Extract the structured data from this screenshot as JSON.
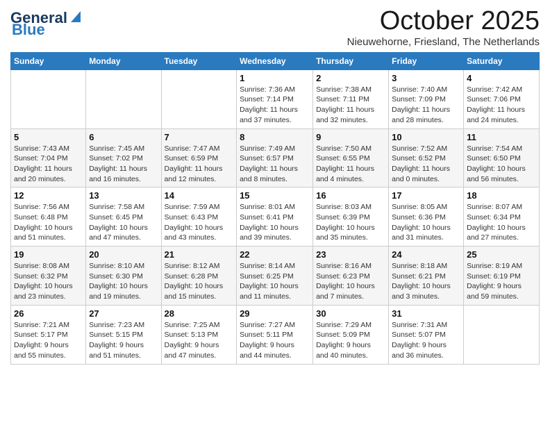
{
  "header": {
    "logo_general": "General",
    "logo_blue": "Blue",
    "month_title": "October 2025",
    "subtitle": "Nieuwehorne, Friesland, The Netherlands"
  },
  "days_of_week": [
    "Sunday",
    "Monday",
    "Tuesday",
    "Wednesday",
    "Thursday",
    "Friday",
    "Saturday"
  ],
  "weeks": [
    [
      {
        "day": "",
        "info": ""
      },
      {
        "day": "",
        "info": ""
      },
      {
        "day": "",
        "info": ""
      },
      {
        "day": "1",
        "info": "Sunrise: 7:36 AM\nSunset: 7:14 PM\nDaylight: 11 hours\nand 37 minutes."
      },
      {
        "day": "2",
        "info": "Sunrise: 7:38 AM\nSunset: 7:11 PM\nDaylight: 11 hours\nand 32 minutes."
      },
      {
        "day": "3",
        "info": "Sunrise: 7:40 AM\nSunset: 7:09 PM\nDaylight: 11 hours\nand 28 minutes."
      },
      {
        "day": "4",
        "info": "Sunrise: 7:42 AM\nSunset: 7:06 PM\nDaylight: 11 hours\nand 24 minutes."
      }
    ],
    [
      {
        "day": "5",
        "info": "Sunrise: 7:43 AM\nSunset: 7:04 PM\nDaylight: 11 hours\nand 20 minutes."
      },
      {
        "day": "6",
        "info": "Sunrise: 7:45 AM\nSunset: 7:02 PM\nDaylight: 11 hours\nand 16 minutes."
      },
      {
        "day": "7",
        "info": "Sunrise: 7:47 AM\nSunset: 6:59 PM\nDaylight: 11 hours\nand 12 minutes."
      },
      {
        "day": "8",
        "info": "Sunrise: 7:49 AM\nSunset: 6:57 PM\nDaylight: 11 hours\nand 8 minutes."
      },
      {
        "day": "9",
        "info": "Sunrise: 7:50 AM\nSunset: 6:55 PM\nDaylight: 11 hours\nand 4 minutes."
      },
      {
        "day": "10",
        "info": "Sunrise: 7:52 AM\nSunset: 6:52 PM\nDaylight: 11 hours\nand 0 minutes."
      },
      {
        "day": "11",
        "info": "Sunrise: 7:54 AM\nSunset: 6:50 PM\nDaylight: 10 hours\nand 56 minutes."
      }
    ],
    [
      {
        "day": "12",
        "info": "Sunrise: 7:56 AM\nSunset: 6:48 PM\nDaylight: 10 hours\nand 51 minutes."
      },
      {
        "day": "13",
        "info": "Sunrise: 7:58 AM\nSunset: 6:45 PM\nDaylight: 10 hours\nand 47 minutes."
      },
      {
        "day": "14",
        "info": "Sunrise: 7:59 AM\nSunset: 6:43 PM\nDaylight: 10 hours\nand 43 minutes."
      },
      {
        "day": "15",
        "info": "Sunrise: 8:01 AM\nSunset: 6:41 PM\nDaylight: 10 hours\nand 39 minutes."
      },
      {
        "day": "16",
        "info": "Sunrise: 8:03 AM\nSunset: 6:39 PM\nDaylight: 10 hours\nand 35 minutes."
      },
      {
        "day": "17",
        "info": "Sunrise: 8:05 AM\nSunset: 6:36 PM\nDaylight: 10 hours\nand 31 minutes."
      },
      {
        "day": "18",
        "info": "Sunrise: 8:07 AM\nSunset: 6:34 PM\nDaylight: 10 hours\nand 27 minutes."
      }
    ],
    [
      {
        "day": "19",
        "info": "Sunrise: 8:08 AM\nSunset: 6:32 PM\nDaylight: 10 hours\nand 23 minutes."
      },
      {
        "day": "20",
        "info": "Sunrise: 8:10 AM\nSunset: 6:30 PM\nDaylight: 10 hours\nand 19 minutes."
      },
      {
        "day": "21",
        "info": "Sunrise: 8:12 AM\nSunset: 6:28 PM\nDaylight: 10 hours\nand 15 minutes."
      },
      {
        "day": "22",
        "info": "Sunrise: 8:14 AM\nSunset: 6:25 PM\nDaylight: 10 hours\nand 11 minutes."
      },
      {
        "day": "23",
        "info": "Sunrise: 8:16 AM\nSunset: 6:23 PM\nDaylight: 10 hours\nand 7 minutes."
      },
      {
        "day": "24",
        "info": "Sunrise: 8:18 AM\nSunset: 6:21 PM\nDaylight: 10 hours\nand 3 minutes."
      },
      {
        "day": "25",
        "info": "Sunrise: 8:19 AM\nSunset: 6:19 PM\nDaylight: 9 hours\nand 59 minutes."
      }
    ],
    [
      {
        "day": "26",
        "info": "Sunrise: 7:21 AM\nSunset: 5:17 PM\nDaylight: 9 hours\nand 55 minutes."
      },
      {
        "day": "27",
        "info": "Sunrise: 7:23 AM\nSunset: 5:15 PM\nDaylight: 9 hours\nand 51 minutes."
      },
      {
        "day": "28",
        "info": "Sunrise: 7:25 AM\nSunset: 5:13 PM\nDaylight: 9 hours\nand 47 minutes."
      },
      {
        "day": "29",
        "info": "Sunrise: 7:27 AM\nSunset: 5:11 PM\nDaylight: 9 hours\nand 44 minutes."
      },
      {
        "day": "30",
        "info": "Sunrise: 7:29 AM\nSunset: 5:09 PM\nDaylight: 9 hours\nand 40 minutes."
      },
      {
        "day": "31",
        "info": "Sunrise: 7:31 AM\nSunset: 5:07 PM\nDaylight: 9 hours\nand 36 minutes."
      },
      {
        "day": "",
        "info": ""
      }
    ]
  ]
}
